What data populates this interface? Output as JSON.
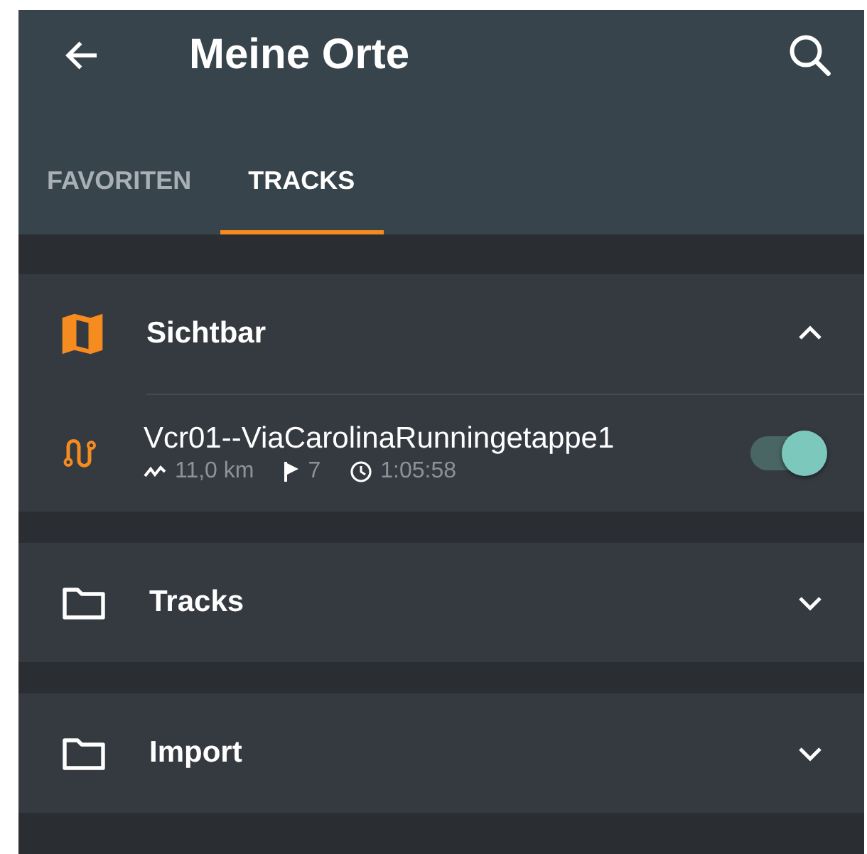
{
  "app_bar": {
    "title": "Meine Orte"
  },
  "tabs": [
    {
      "label": "FAVORITEN",
      "selected": false
    },
    {
      "label": "TRACKS",
      "selected": true
    }
  ],
  "groups": [
    {
      "kind": "map",
      "name": "Sichtbar",
      "expanded": true,
      "tracks": [
        {
          "name": "Vcr01--ViaCarolinaRunningetappe1",
          "distance": "11,0 km",
          "waypoints": "7",
          "duration": "1:05:58",
          "on": true
        }
      ]
    },
    {
      "kind": "folder",
      "name": "Tracks",
      "expanded": false
    },
    {
      "kind": "folder",
      "name": "Import",
      "expanded": false
    }
  ]
}
